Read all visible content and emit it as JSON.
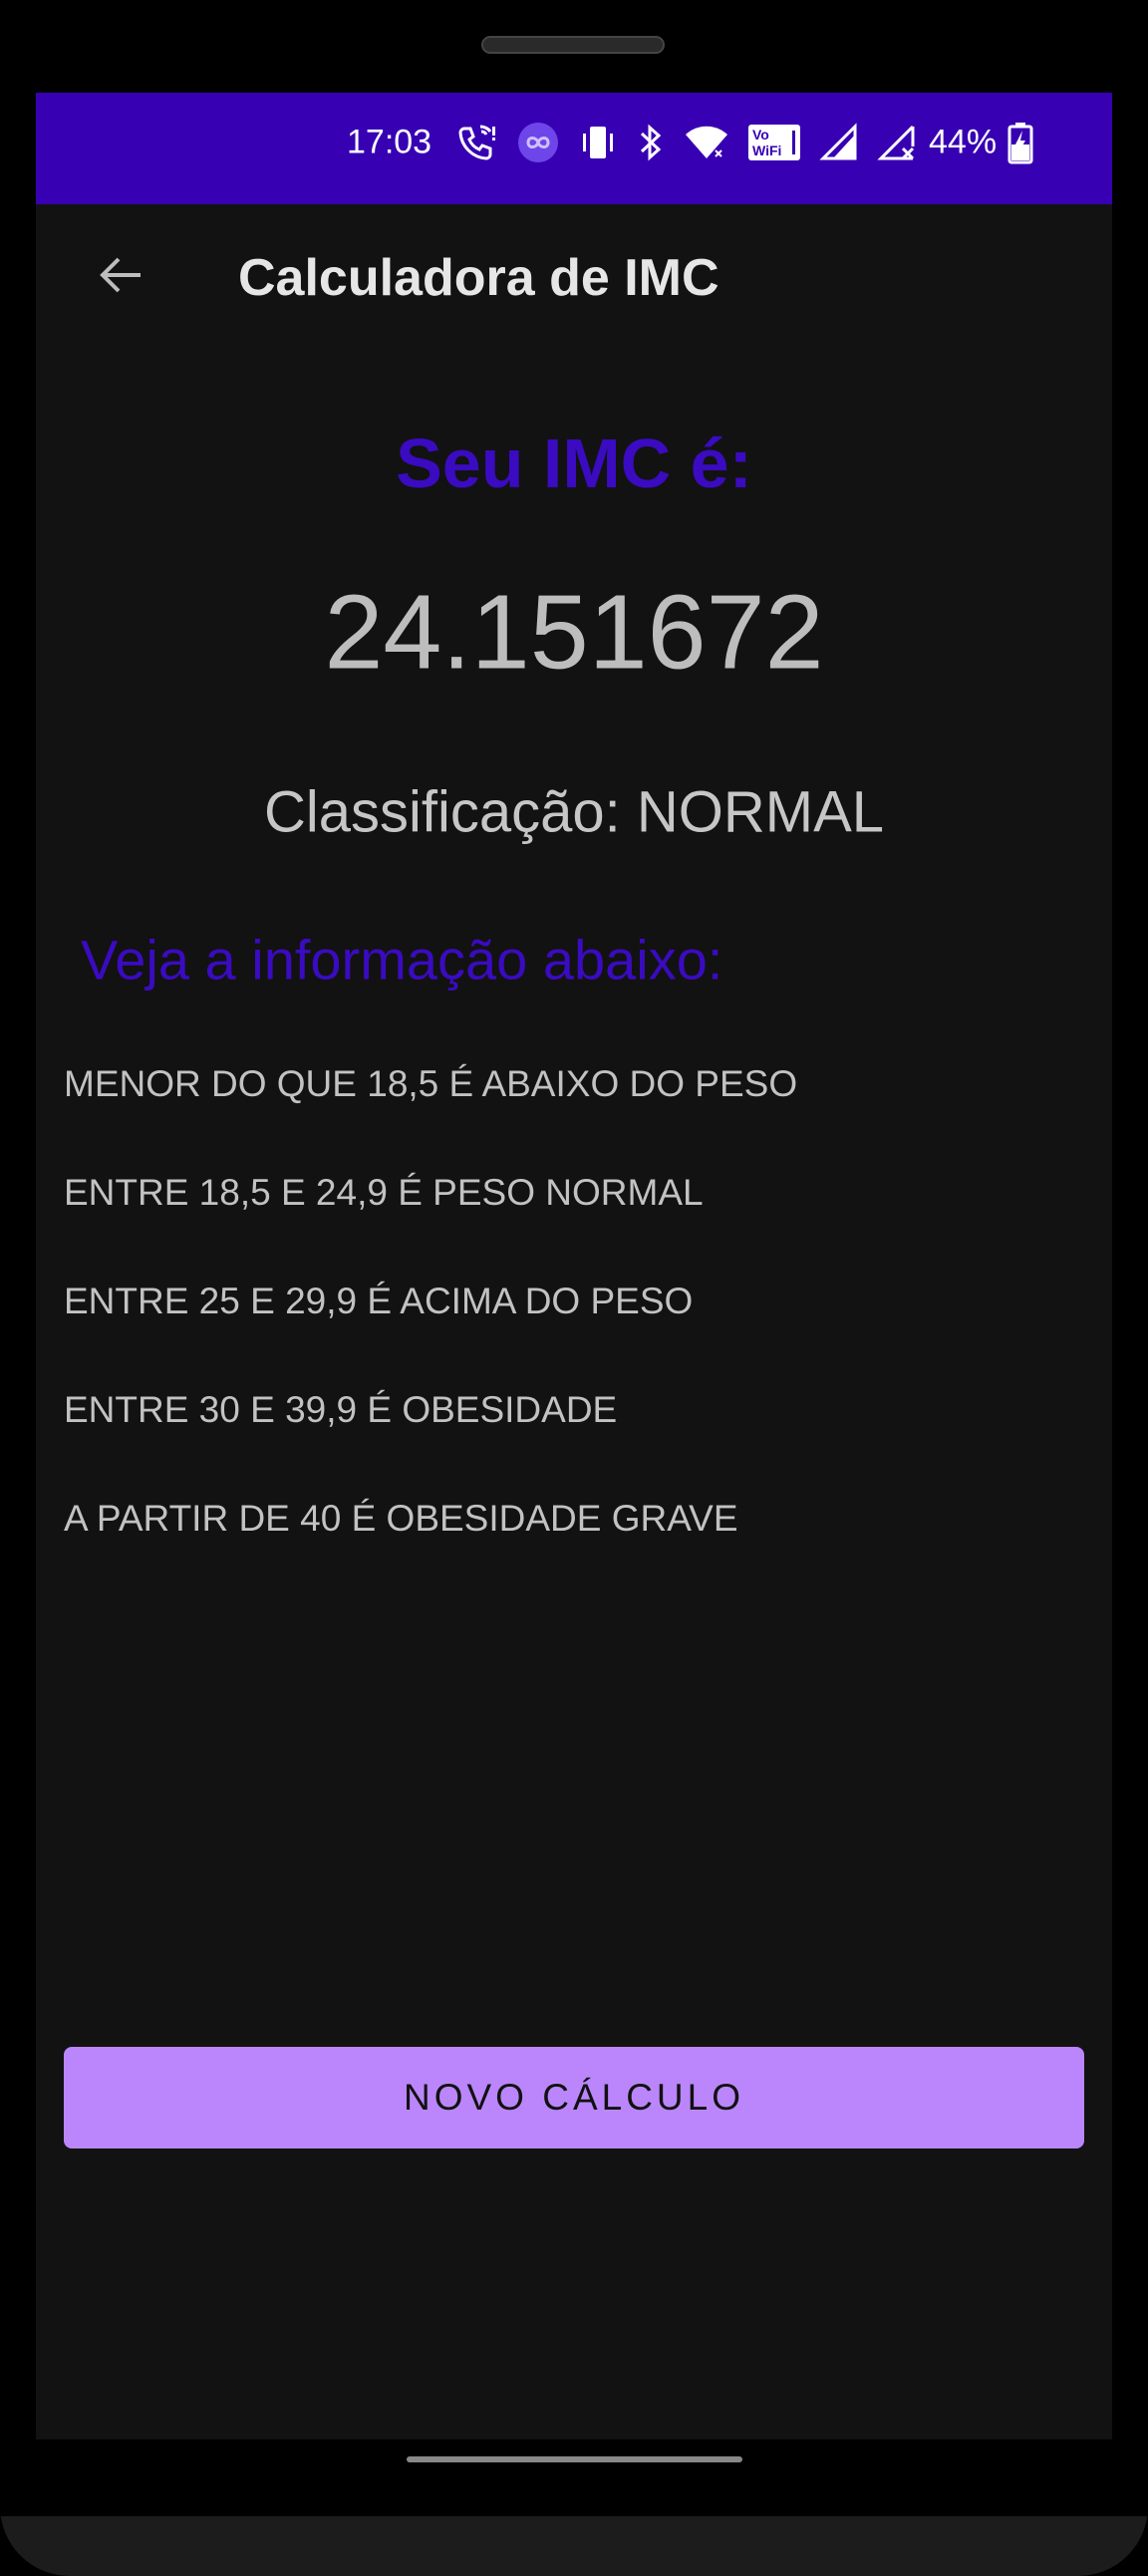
{
  "status_bar": {
    "time": "17:03",
    "battery_percent": "44%",
    "background_color": "#3700b3",
    "icons": [
      "wifi-calling-icon",
      "infinity-icon",
      "vibrate-icon",
      "bluetooth-icon",
      "wifi-icon",
      "vowifi-icon",
      "signal-icon",
      "signal-no-service-icon",
      "battery-charging-icon"
    ],
    "vowifi_label_top": "Vo",
    "vowifi_label_bottom": "WiFi"
  },
  "app_bar": {
    "title": "Calculadora de IMC",
    "back_icon": "arrow-back-icon"
  },
  "result": {
    "title": "Seu IMC é:",
    "value": "24.151672",
    "classification": "Classificação: NORMAL"
  },
  "info": {
    "heading": "Veja a informação abaixo:",
    "items": [
      "MENOR DO QUE 18,5 É ABAIXO DO PESO",
      "ENTRE 18,5 E 24,9 É PESO NORMAL",
      "ENTRE 25 E 29,9 É ACIMA DO PESO",
      "ENTRE 30 E 39,9 É OBESIDADE",
      "A PARTIR DE 40 É OBESIDADE GRAVE"
    ]
  },
  "actions": {
    "new_calc_label": "NOVO CÁLCULO"
  },
  "colors": {
    "accent": "#3a0bc0",
    "button": "#bb86fc",
    "background": "#121212"
  }
}
